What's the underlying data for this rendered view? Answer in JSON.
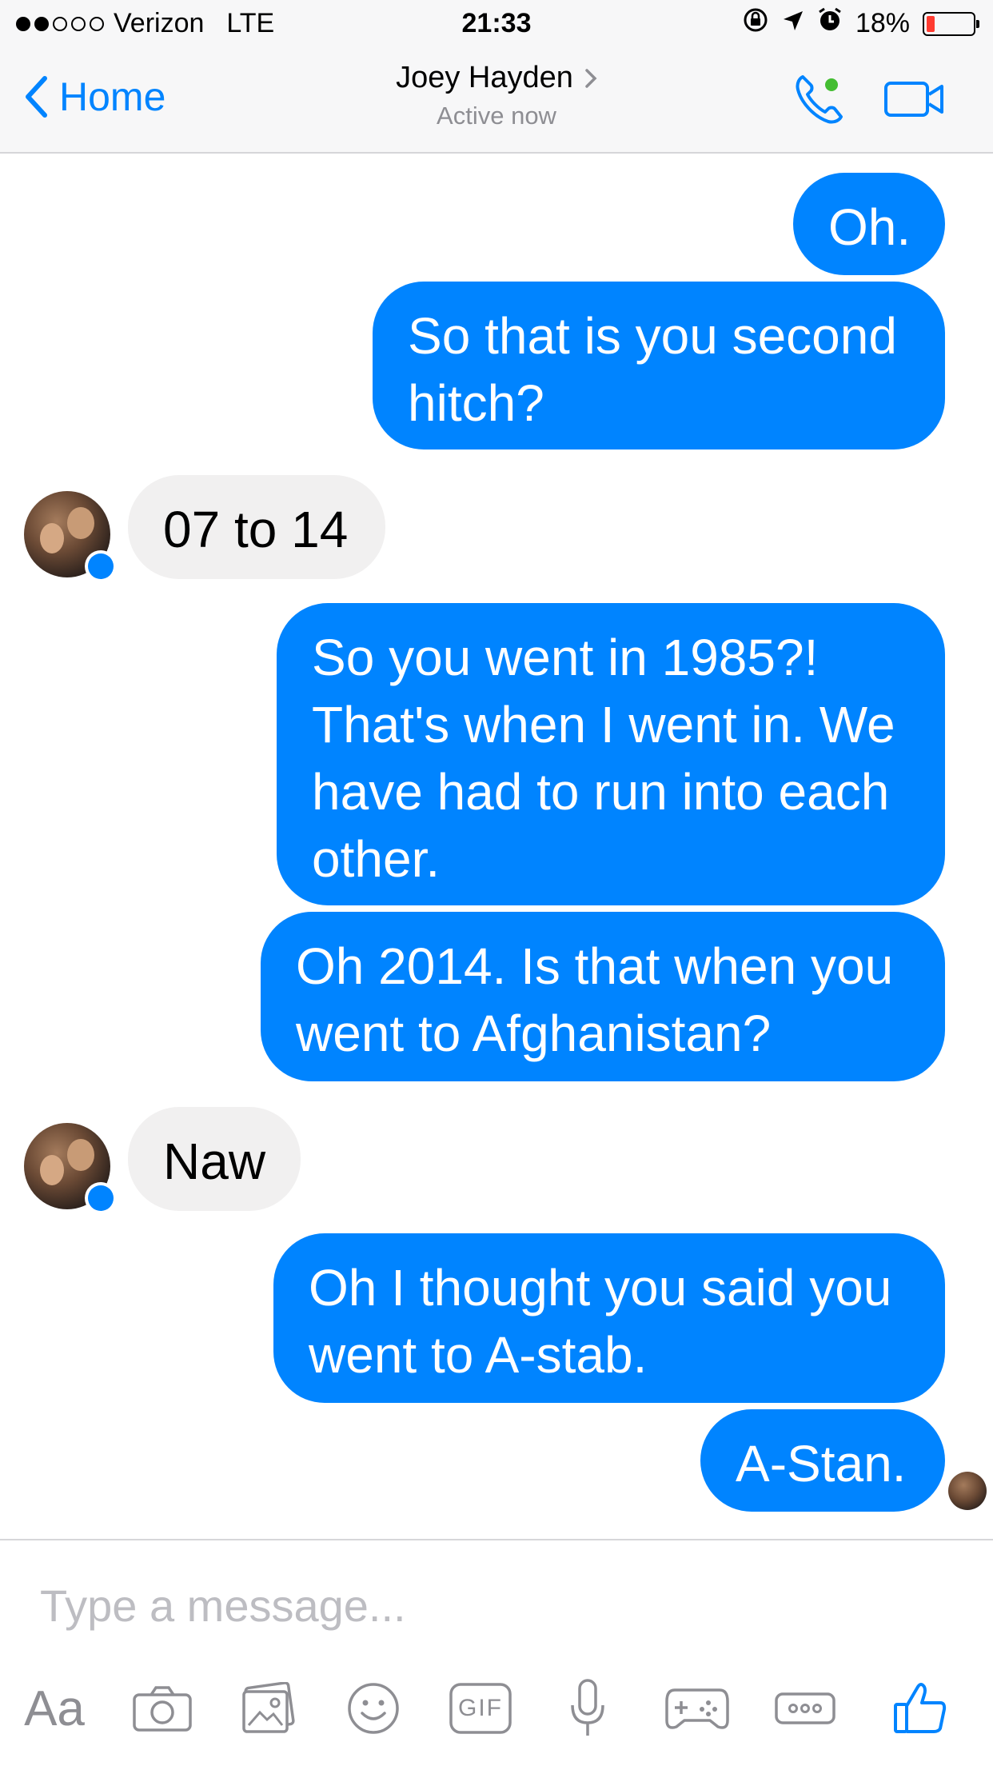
{
  "status_bar": {
    "carrier": "Verizon",
    "network": "LTE",
    "time": "21:33",
    "battery_percent_label": "18%",
    "battery_level": 0.18,
    "signal_bars_filled": 2,
    "signal_bars_total": 5
  },
  "nav": {
    "back_label": "Home",
    "contact_name": "Joey Hayden",
    "contact_status": "Active now",
    "accent_color": "#0084ff",
    "presence_color": "#44bd32"
  },
  "messages": [
    {
      "side": "out",
      "text": "Oh."
    },
    {
      "side": "out",
      "text": "So that is you second\nhitch?"
    },
    {
      "side": "in",
      "text": "07 to 14"
    },
    {
      "side": "out",
      "text": "So you went in 1985?!\nThat's when I went in. We\nhave had to run into each\nother."
    },
    {
      "side": "out",
      "text": "Oh 2014. Is that when you\nwent to Afghanistan?"
    },
    {
      "side": "in",
      "text": "Naw"
    },
    {
      "side": "out",
      "text": "Oh I thought you said you\nwent to A-stab."
    },
    {
      "side": "out",
      "text": "A-Stan."
    }
  ],
  "composer": {
    "placeholder": "Type a message...",
    "aa_label": "Aa",
    "gif_label": "GIF",
    "tools": [
      "camera-icon",
      "photo-icon",
      "emoji-icon",
      "gif-icon",
      "microphone-icon",
      "game-controller-icon",
      "more-icon",
      "thumbs-up-icon"
    ]
  }
}
